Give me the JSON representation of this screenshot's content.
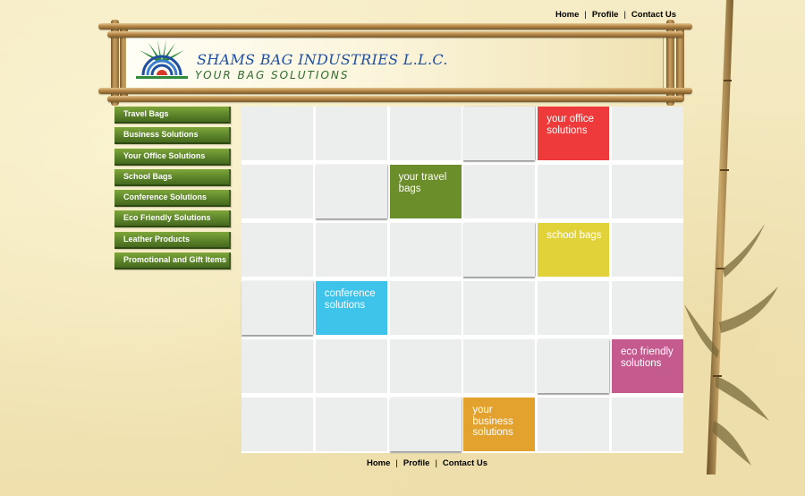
{
  "nav_top": [
    "Home",
    "Profile",
    "Contact Us"
  ],
  "nav_bottom": [
    "Home",
    "Profile",
    "Contact Us"
  ],
  "header": {
    "company": "SHAMS BAG INDUSTRIES L.L.C.",
    "tagline": "YOUR BAG SOLUTIONS"
  },
  "menu": [
    "Travel Bags",
    "Business Solutions",
    "Your Office Solutions",
    "School Bags",
    "Conference Solutions",
    "Eco Friendly Solutions",
    "Leather Products",
    "Promotional and Gift Items"
  ],
  "tiles": [
    {
      "lines": [
        "your office",
        "solutions"
      ],
      "color": "#ee3a3a"
    },
    {
      "lines": [
        "your travel",
        "bags"
      ],
      "color": "#6b8d2a"
    },
    {
      "lines": [
        "school bags"
      ],
      "color": "#e2d23a"
    },
    {
      "lines": [
        "conference",
        "solutions"
      ],
      "color": "#3ec3ea"
    },
    {
      "lines": [
        "eco friendly",
        "solutions"
      ],
      "color": "#c55a8f"
    },
    {
      "lines": [
        "your",
        "business",
        "solutions"
      ],
      "color": "#e3a22d"
    }
  ]
}
